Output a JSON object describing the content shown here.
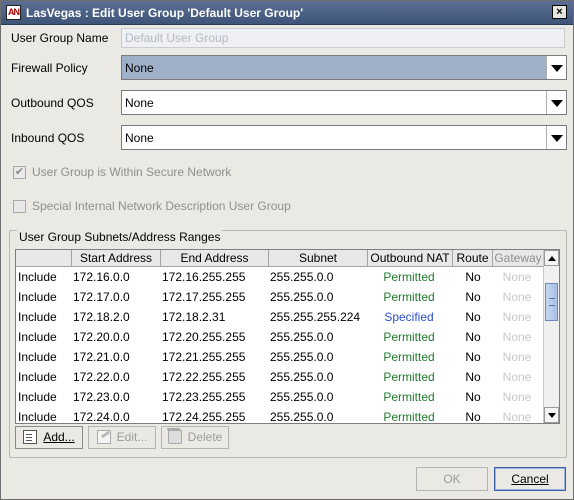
{
  "window": {
    "app_icon_text": "AN",
    "title": "LasVegas : Edit User Group 'Default User Group'",
    "close_glyph": "×"
  },
  "form": {
    "user_group_name_label": "User Group Name",
    "user_group_name_value": "Default User Group",
    "firewall_policy_label": "Firewall Policy",
    "firewall_policy_value": "None",
    "outbound_qos_label": "Outbound QOS",
    "outbound_qos_value": "None",
    "inbound_qos_label": "Inbound QOS",
    "inbound_qos_value": "None",
    "secure_network_label": "User Group is Within Secure Network",
    "secure_network_checked": true,
    "special_internal_label": "Special Internal Network Description User Group",
    "special_internal_checked": false
  },
  "subnets": {
    "group_title": "User Group Subnets/Address Ranges",
    "columns": [
      "",
      "Start Address",
      "End Address",
      "Subnet",
      "Outbound NAT",
      "Route",
      "Gateway"
    ],
    "rows": [
      {
        "type": "Include",
        "start": "172.16.0.0",
        "end": "172.16.255.255",
        "subnet": "255.255.0.0",
        "nat": "Permitted",
        "route": "No",
        "gateway": "None"
      },
      {
        "type": "Include",
        "start": "172.17.0.0",
        "end": "172.17.255.255",
        "subnet": "255.255.0.0",
        "nat": "Permitted",
        "route": "No",
        "gateway": "None"
      },
      {
        "type": "Include",
        "start": "172.18.2.0",
        "end": "172.18.2.31",
        "subnet": "255.255.255.224",
        "nat": "Specified",
        "route": "No",
        "gateway": "None"
      },
      {
        "type": "Include",
        "start": "172.20.0.0",
        "end": "172.20.255.255",
        "subnet": "255.255.0.0",
        "nat": "Permitted",
        "route": "No",
        "gateway": "None"
      },
      {
        "type": "Include",
        "start": "172.21.0.0",
        "end": "172.21.255.255",
        "subnet": "255.255.0.0",
        "nat": "Permitted",
        "route": "No",
        "gateway": "None"
      },
      {
        "type": "Include",
        "start": "172.22.0.0",
        "end": "172.22.255.255",
        "subnet": "255.255.0.0",
        "nat": "Permitted",
        "route": "No",
        "gateway": "None"
      },
      {
        "type": "Include",
        "start": "172.23.0.0",
        "end": "172.23.255.255",
        "subnet": "255.255.0.0",
        "nat": "Permitted",
        "route": "No",
        "gateway": "None"
      },
      {
        "type": "Include",
        "start": "172.24.0.0",
        "end": "172.24.255.255",
        "subnet": "255.255.0.0",
        "nat": "Permitted",
        "route": "No",
        "gateway": "None"
      }
    ],
    "add_label": "Add...",
    "edit_label": "Edit...",
    "delete_label": "Delete"
  },
  "footer": {
    "ok_label": "OK",
    "cancel_label": "Cancel"
  }
}
